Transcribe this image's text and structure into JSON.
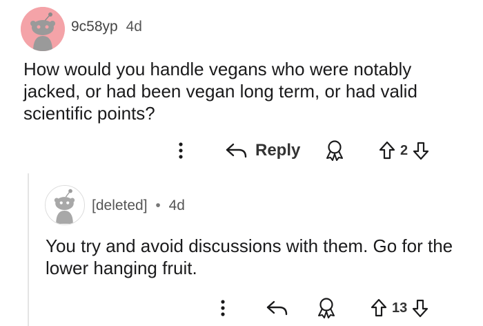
{
  "comments": [
    {
      "username": "9c58yp",
      "age": "4d",
      "body": "How would you handle vegans who were notably jacked, or had been vegan long term, or had valid scientific points?",
      "actions": {
        "reply_label": "Reply",
        "score": "2"
      },
      "avatar_color": "#f4a3a8"
    },
    {
      "username": "[deleted]",
      "separator": "•",
      "age": "4d",
      "body": "You try and avoid discussions with them. Go for the lower hanging fruit.",
      "actions": {
        "score": "13"
      },
      "avatar_color": "#ffffff"
    }
  ],
  "icons": {
    "more": "more-vertical-icon",
    "reply": "reply-arrow-icon",
    "award": "award-icon",
    "upvote": "upvote-arrow-icon",
    "downvote": "downvote-arrow-icon"
  }
}
